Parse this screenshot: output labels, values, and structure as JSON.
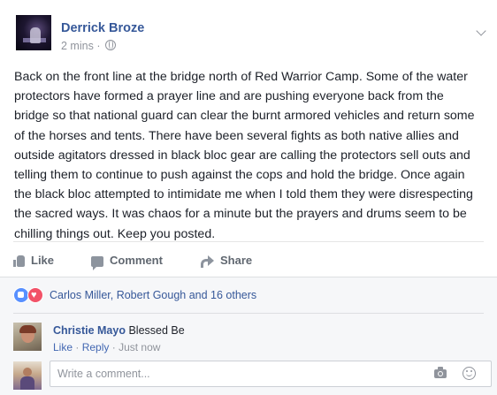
{
  "post": {
    "author": "Derrick Broze",
    "timestamp": "2 mins",
    "separator": "·",
    "privacy_icon": "globe-icon",
    "options_icon": "chevron-down-icon",
    "body": "Back on the front line at the bridge north of Red Warrior Camp. Some of the water protectors have formed a prayer line and are pushing everyone back from the bridge so that national guard can clear the burnt armored vehicles and return some of the horses and tents. There have been several fights as both native allies and outside agitators dressed in black bloc gear are calling the protectors sell outs and telling them to continue to push against the cops and hold the bridge. Once again the black bloc attempted to intimidate me when I told them they were disrespecting the sacred ways. It was chaos for a minute but the prayers and drums seem to be chilling things out. Keep you posted."
  },
  "actions": {
    "like": "Like",
    "comment": "Comment",
    "share": "Share"
  },
  "reactions": {
    "icons": [
      "like-reaction-icon",
      "love-reaction-icon"
    ],
    "summary": "Carlos Miller, Robert Gough and 16 others"
  },
  "comments": [
    {
      "author": "Christie Mayo",
      "text": "Blessed Be",
      "like_label": "Like",
      "reply_label": "Reply",
      "separator": "·",
      "time": "Just now"
    }
  ],
  "composer": {
    "placeholder": "Write a comment...",
    "icons": [
      "camera-icon",
      "smiley-icon"
    ]
  },
  "colors": {
    "link": "#365899",
    "text": "#1d2129",
    "muted": "#90949c",
    "like_blue": "#5890ff",
    "love_red": "#f25268"
  }
}
